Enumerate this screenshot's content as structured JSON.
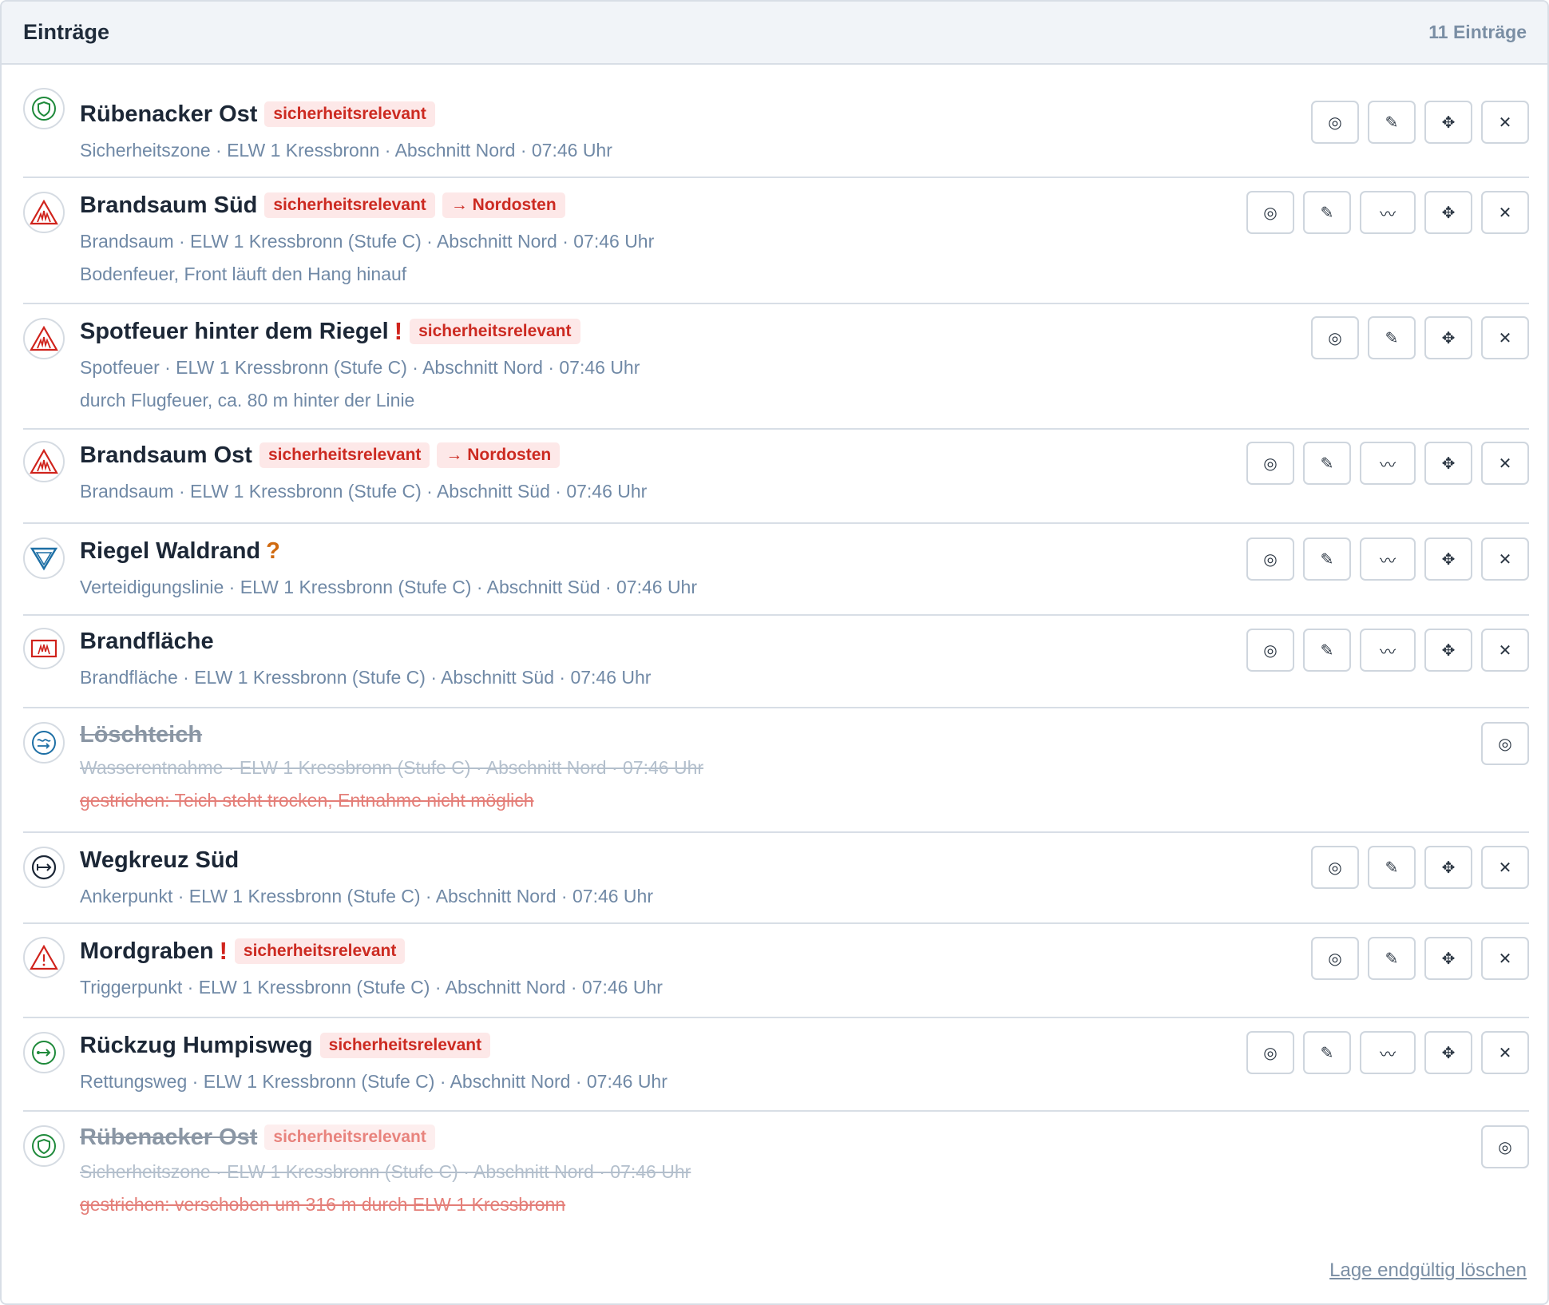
{
  "header": {
    "title": "Einträge",
    "count": "11 Einträge"
  },
  "entries": [
    {
      "title": "Rübenacker Ost",
      "tag": "sicherheitsrelevant",
      "meta": "Sicherheitszone · ELW 1 Kressbronn · Abschnitt Nord · 07:46 Uhr",
      "icon": "shield-icon",
      "icon_color": "#1f8a3b"
    },
    {
      "title": "Brandsaum Süd",
      "tag": "sicherheitsrelevant",
      "direction": "→ Nordosten",
      "meta": "Brandsaum · ELW 1 Kressbronn (Stufe C) · Abschnitt Nord · 07:46 Uhr",
      "note": "Bodenfeuer, Front läuft den Hang hinauf",
      "icon": "fire-front-icon",
      "icon_color": "#d0231c"
    },
    {
      "title": "Spotfeuer hinter dem Riegel",
      "mark": "!",
      "tag": "sicherheitsrelevant",
      "meta": "Spotfeuer · ELW 1 Kressbronn (Stufe C) · Abschnitt Nord · 07:46 Uhr",
      "note": "durch Flugfeuer, ca. 80 m hinter der Linie",
      "icon": "fire-front-icon",
      "icon_color": "#d0231c"
    },
    {
      "title": "Brandsaum Ost",
      "tag": "sicherheitsrelevant",
      "direction": "→ Nordosten",
      "meta": "Brandsaum · ELW 1 Kressbronn (Stufe C) · Abschnitt Süd · 07:46 Uhr",
      "icon": "fire-front-icon",
      "icon_color": "#d0231c"
    },
    {
      "title": "Riegel Waldrand",
      "mark": "?",
      "meta": "Verteidigungslinie · ELW 1 Kressbronn (Stufe C) · Abschnitt Süd · 07:46 Uhr",
      "icon": "defense-line-icon",
      "icon_color": "#1d6fa5"
    },
    {
      "title": "Brandfläche",
      "meta": "Brandfläche · ELW 1 Kressbronn (Stufe C) · Abschnitt Süd · 07:46 Uhr",
      "icon": "fire-area-icon",
      "icon_color": "#d0231c"
    },
    {
      "title": "Löschteich",
      "meta": "Wasserentnahme · ELW 1 Kressbronn (Stufe C) · Abschnitt Nord · 07:46 Uhr",
      "note": "gestrichen: Teich steht trocken, Entnahme nicht möglich",
      "icon": "water-source-icon",
      "icon_color": "#1d6fa5"
    },
    {
      "title": "Wegkreuz Süd",
      "meta": "Ankerpunkt · ELW 1 Kressbronn (Stufe C) · Abschnitt Nord · 07:46 Uhr",
      "icon": "anchor-point-icon",
      "icon_color": "#1c2736"
    },
    {
      "title": "Mordgraben",
      "mark": "!",
      "tag": "sicherheitsrelevant",
      "meta": "Triggerpunkt · ELW 1 Kressbronn (Stufe C) · Abschnitt Nord · 07:46 Uhr",
      "icon": "warning-triangle-icon",
      "icon_color": "#d0231c"
    },
    {
      "title": "Rückzug Humpisweg",
      "tag": "sicherheitsrelevant",
      "meta": "Rettungsweg · ELW 1 Kressbronn (Stufe C) · Abschnitt Nord · 07:46 Uhr",
      "icon": "escape-route-icon",
      "icon_color": "#1f8a3b"
    },
    {
      "title": "Rübenacker Ost",
      "tag": "sicherheitsrelevant",
      "meta": "Sicherheitszone · ELW 1 Kressbronn (Stufe C) · Abschnitt Nord · 07:46 Uhr",
      "note": "gestrichen: verschoben um 316 m durch ELW 1 Kressbronn",
      "icon": "shield-icon",
      "icon_color": "#1f8a3b"
    }
  ],
  "action_icons": {
    "locate": "◎",
    "edit": "✎",
    "line": "〰",
    "move": "✥",
    "delete": "✕"
  },
  "footer": {
    "delete_link": "Lage endgültig löschen"
  }
}
